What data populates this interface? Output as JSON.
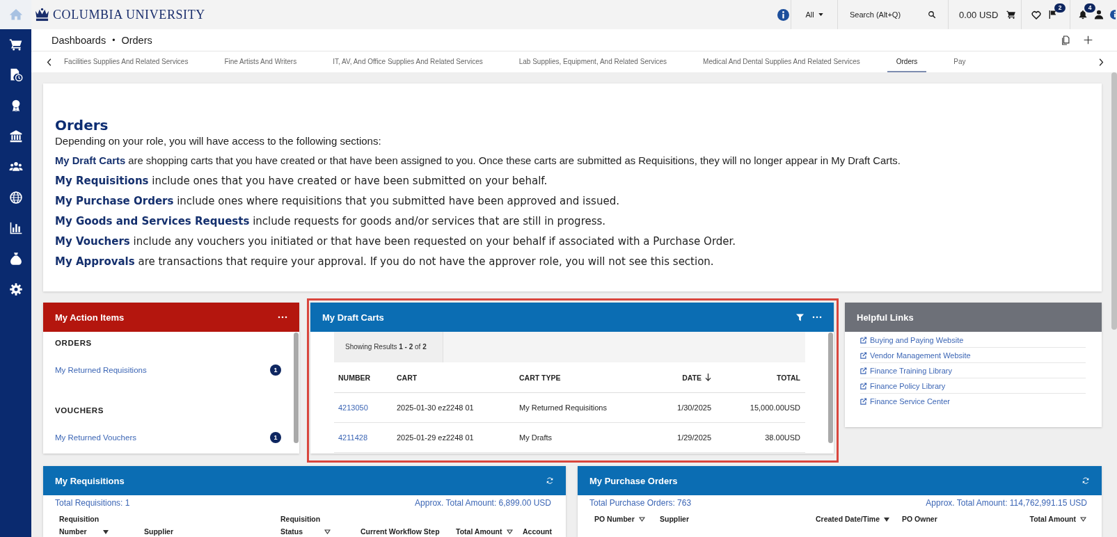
{
  "top_bar": {
    "logo": "COLUMBIA UNIVERSITY",
    "search_scope": "All",
    "search": {
      "placeholder": "Search (Alt+Q)"
    },
    "cart_total": "0.00 USD",
    "flag_count": "2",
    "alert_count": "4"
  },
  "breadcrumb": {
    "items": [
      "Dashboards",
      "Orders"
    ],
    "separator": "•"
  },
  "tabs": [
    {
      "label": "Facilities Supplies And Related Services",
      "selected": false
    },
    {
      "label": "Fine Artists And Writers",
      "selected": false
    },
    {
      "label": "IT, AV, And Office Supplies And Related Services",
      "selected": false
    },
    {
      "label": "Lab Supplies, Equipment, And Related Services",
      "selected": false
    },
    {
      "label": "Medical And Dental Supplies And Related Services",
      "selected": false
    },
    {
      "label": "Orders",
      "selected": true
    },
    {
      "label": "Pay",
      "selected": false
    }
  ],
  "intro": {
    "title": "Orders",
    "lead": "Depending on your role, you will have access to the following sections:",
    "sections": [
      {
        "kind": "compact",
        "text": "**My Draft Carts** are shopping carts that you have created or that have been assigned to you. Once these carts are submitted as Requisitions, they will no longer appear in My Draft Carts."
      },
      {
        "kind": "wide",
        "text": "**My Requisitions** include ones that you have created or have been submitted on your behalf."
      },
      {
        "kind": "wide",
        "text": "**My Purchase Orders** include ones where requisitions that you submitted have been approved and issued."
      },
      {
        "kind": "wide",
        "text": "**My Goods and Services Requests** include requests for goods and/or services that are still in progress."
      },
      {
        "kind": "wide",
        "text": "**My Vouchers** include any vouchers you initiated or that have been requested on your behalf if associated with a Purchase Order."
      },
      {
        "kind": "wide",
        "text": "**My Approvals** are transactions that require your approval. If you do not have the approver role, you will not see this section."
      }
    ]
  },
  "action_items": {
    "title": "My Action Items",
    "groups": [
      {
        "heading": "ORDERS",
        "items": [
          {
            "label": "My Returned Requisitions",
            "count": "1"
          }
        ]
      },
      {
        "heading": "VOUCHERS",
        "items": [
          {
            "label": "My Returned Vouchers",
            "count": "1"
          }
        ]
      }
    ]
  },
  "draft_carts": {
    "title": "My Draft Carts",
    "highlighted": true,
    "summary": "Showing Results **1 - 2** of **2**",
    "columns": [
      {
        "label": "NUMBER",
        "sorted": false
      },
      {
        "label": "CART",
        "sorted": false
      },
      {
        "label": "CART TYPE",
        "sorted": false
      },
      {
        "label": "DATE",
        "sorted": true
      },
      {
        "label": "TOTAL",
        "sorted": false
      }
    ],
    "rows": [
      {
        "number": "4213050",
        "cart": "2025-01-30 ez2248 01",
        "cart_type": "My Returned Requisitions",
        "date": "1/30/2025",
        "total": "15,000.00USD"
      },
      {
        "number": "4211428",
        "cart": "2025-01-29 ez2248 01",
        "cart_type": "My Drafts",
        "date": "1/29/2025",
        "total": "38.00USD"
      }
    ]
  },
  "helpful_links": {
    "title": "Helpful Links",
    "links": [
      "Buying and Paying Website",
      "Vendor Management Website",
      "Finance Training Library",
      "Finance Policy Library",
      "Finance Service Center"
    ]
  },
  "requisitions": {
    "title": "My Requisitions",
    "total": "Total Requisitions: 1",
    "amount": "Approx. Total Amount: 6,899.00 USD",
    "columns": [
      {
        "label": "Requisition Number",
        "sorted": true,
        "sortable": false
      },
      {
        "label": "Supplier",
        "sorted": false,
        "sortable": false
      },
      {
        "label": "Requisition Status",
        "sorted": false,
        "sortable": true
      },
      {
        "label": "Current Workflow Step",
        "sorted": false,
        "sortable": false
      },
      {
        "label": "Total Amount",
        "sorted": false,
        "sortable": true
      },
      {
        "label": "Account",
        "sorted": false,
        "sortable": false
      }
    ]
  },
  "purchase_orders": {
    "title": "My Purchase Orders",
    "total": "Total Purchase Orders: 763",
    "amount": "Approx. Total Amount: 114,762,991.15 USD",
    "columns": [
      {
        "label": "PO Number",
        "sorted": false,
        "sortable": true
      },
      {
        "label": "Supplier",
        "sorted": false,
        "sortable": false
      },
      {
        "label": "Created Date/Time",
        "sorted": true,
        "sortable": false
      },
      {
        "label": "PO Owner",
        "sorted": false,
        "sortable": false
      },
      {
        "label": "Total Amount",
        "sorted": false,
        "sortable": true
      }
    ]
  }
}
